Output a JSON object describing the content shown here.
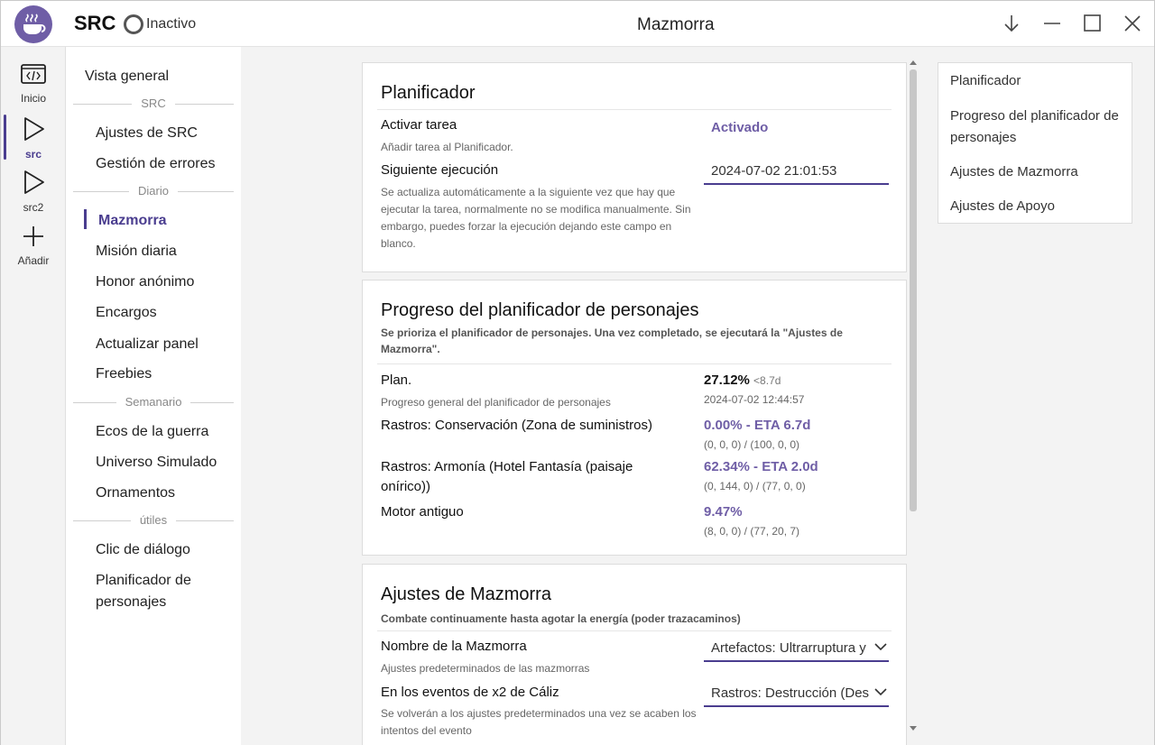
{
  "app": {
    "brand": "SRC",
    "status": "Inactivo",
    "window_title": "Mazmorra"
  },
  "rail": [
    {
      "label": "Inicio",
      "icon": "code-window-icon"
    },
    {
      "label": "src",
      "icon": "play-icon"
    },
    {
      "label": "src2",
      "icon": "play-icon"
    },
    {
      "label": "Añadir",
      "icon": "plus-icon"
    }
  ],
  "nav": {
    "overview": "Vista general",
    "section_src": "SRC",
    "src_settings": "Ajustes de SRC",
    "error_handling": "Gestión de errores",
    "section_daily": "Diario",
    "dungeon": "Mazmorra",
    "daily_mission": "Misión diaria",
    "anon_honor": "Honor anónimo",
    "commissions": "Encargos",
    "refresh_panel": "Actualizar panel",
    "freebies": "Freebies",
    "section_weekly": "Semanario",
    "war_echoes": "Ecos de la guerra",
    "sim_universe": "Universo Simulado",
    "ornaments": "Ornamentos",
    "section_tools": "útiles",
    "dialog_click": "Clic de diálogo",
    "character_planner_line1": "Planificador de",
    "character_planner_line2": "personajes"
  },
  "scheduler": {
    "title": "Planificador",
    "enable_task_label": "Activar tarea",
    "enable_task_help": "Añadir tarea al Planificador.",
    "enable_task_value": "Activado",
    "next_run_label": "Siguiente ejecución",
    "next_run_help": "Se actualiza automáticamente a la siguiente vez que hay que ejecutar la tarea, normalmente no se modifica manualmente. Sin embargo, puedes forzar la ejecución dejando este campo en blanco.",
    "next_run_value": "2024-07-02 21:01:53"
  },
  "planner": {
    "title": "Progreso del planificador de personajes",
    "subtitle": "Se prioriza el planificador de personajes. Una vez completado, se ejecutará la \"Ajustes de Mazmorra\".",
    "plan_label": "Plan.",
    "plan_help": "Progreso general del planificador de personajes",
    "plan_value": "27.12%",
    "plan_eta": "<8.7d",
    "plan_time": "2024-07-02 12:44:57",
    "rows": [
      {
        "label": "Rastros: Conservación (Zona de suministros)",
        "value": "0.00% - ETA 6.7d",
        "detail": "(0, 0, 0) / (100, 0, 0)"
      },
      {
        "label": "Rastros: Armonía (Hotel Fantasía (paisaje onírico))",
        "value": "62.34% - ETA 2.0d",
        "detail": "(0, 144, 0) / (77, 0, 0)"
      },
      {
        "label": "Motor antiguo",
        "value": "9.47%",
        "detail": "(8, 0, 0) / (77, 20, 7)"
      }
    ]
  },
  "dungeon_settings": {
    "title": "Ajustes de Mazmorra",
    "subtitle": "Combate continuamente hasta agotar la energía (poder trazacaminos)",
    "name_label": "Nombre de la Mazmorra",
    "name_help": "Ajustes predeterminados de las mazmorras",
    "name_value": "Artefactos: Ultrarruptura y",
    "event_label": "En los eventos de x2 de Cáliz",
    "event_help": "Se volverán a los ajustes predeterminados una vez se acaben los intentos del evento",
    "event_value": "Rastros: Destrucción (Des"
  },
  "toc": [
    "Planificador",
    "Progreso del planificador de personajes",
    "Ajustes de Mazmorra",
    "Ajustes de Apoyo"
  ],
  "colors": {
    "accent": "#4a3d8f",
    "accent_light": "#6f5ea6"
  }
}
